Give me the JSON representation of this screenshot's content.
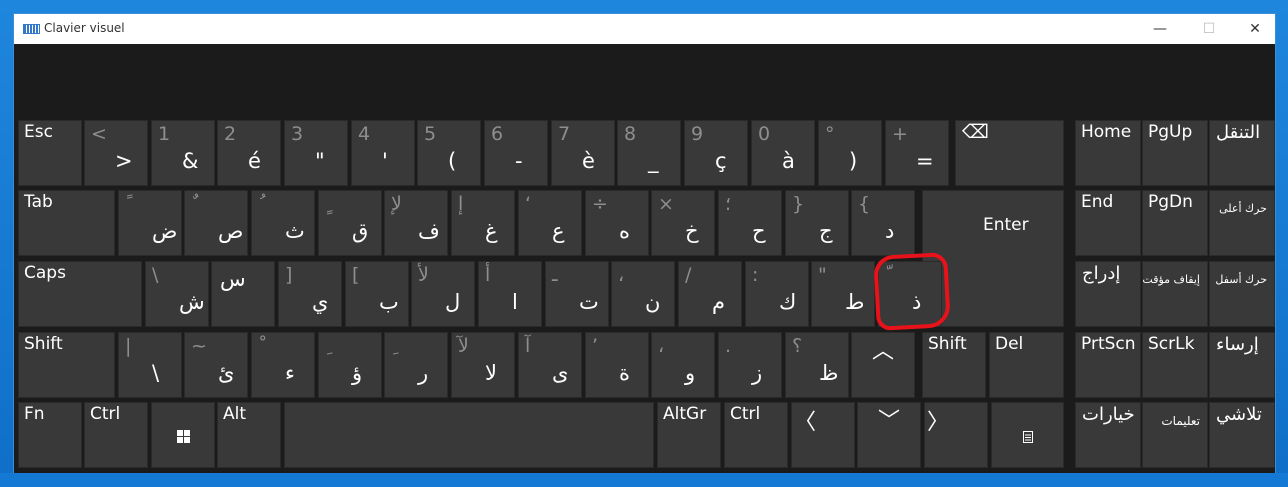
{
  "window": {
    "title": "Clavier visuel",
    "minimize": "—",
    "maximize": "☐",
    "close": "✕"
  },
  "icons": {
    "app": "keyboard-icon",
    "windows": "windows-logo-icon",
    "menu": "menu-icon",
    "backspace": "backspace-icon"
  },
  "colors": {
    "key_bg": "#393939",
    "panel_bg": "#1b1b1b",
    "annotation": "#e8121a",
    "desktop": "#1a7fd6"
  },
  "row1": {
    "esc": "Esc",
    "k_lt": {
      "top": "<",
      "bot": ">"
    },
    "k1": {
      "top": "1",
      "bot": "&"
    },
    "k2": {
      "top": "2",
      "bot": "é"
    },
    "k3": {
      "top": "3",
      "bot": "\""
    },
    "k4": {
      "top": "4",
      "bot": "'"
    },
    "k5": {
      "top": "5",
      "bot": "("
    },
    "k6": {
      "top": "6",
      "bot": "-"
    },
    "k7": {
      "top": "7",
      "bot": "è"
    },
    "k8": {
      "top": "8",
      "bot": "_"
    },
    "k9": {
      "top": "9",
      "bot": "ç"
    },
    "k0": {
      "top": "0",
      "bot": "à"
    },
    "kdeg": {
      "top": "°",
      "bot": ")"
    },
    "kplus": {
      "top": "+",
      "bot": "="
    },
    "backspace": "⌫"
  },
  "row2": {
    "tab": "Tab",
    "a": {
      "top": "ً",
      "bot": "ض"
    },
    "z": {
      "top": "ٌ",
      "bot": "ص"
    },
    "e": {
      "top": "ُ",
      "bot": "ث"
    },
    "r": {
      "top": "ٍ",
      "bot": "ق"
    },
    "t": {
      "top": "لإ",
      "bot": "ف"
    },
    "y": {
      "top": "إ",
      "bot": "غ"
    },
    "u": {
      "top": "‘",
      "bot": "ع"
    },
    "i": {
      "top": "÷",
      "bot": "ه"
    },
    "o": {
      "top": "×",
      "bot": "خ"
    },
    "p": {
      "top": "؛",
      "bot": "ح"
    },
    "brace_r": {
      "top": "}",
      "bot": "ج"
    },
    "brace_l": {
      "top": "{",
      "bot": "د"
    },
    "enter": "Enter"
  },
  "row3": {
    "caps": "Caps",
    "q": {
      "top": "\\",
      "bot": "ش"
    },
    "s": {
      "top": "",
      "bot": "س"
    },
    "d": {
      "top": "]",
      "bot": "ي"
    },
    "f": {
      "top": "[",
      "bot": "ب"
    },
    "g": {
      "top": "لأ",
      "bot": "ل"
    },
    "h": {
      "top": "أ",
      "bot": "ا"
    },
    "j": {
      "top": "ـ",
      "bot": "ت"
    },
    "k": {
      "top": "،",
      "bot": "ن"
    },
    "l": {
      "top": "/",
      "bot": "م"
    },
    "m": {
      "top": ":",
      "bot": "ك"
    },
    "u2": {
      "top": "\"",
      "bot": "ط"
    },
    "star": {
      "top": "ّ",
      "bot": "ذ"
    }
  },
  "row4": {
    "shift": "Shift",
    "pipe": {
      "top": "|",
      "bot": "\\"
    },
    "w": {
      "top": "~",
      "bot": "ئ"
    },
    "x": {
      "top": "ْ",
      "bot": "ء"
    },
    "c": {
      "top": "ِ",
      "bot": "ؤ"
    },
    "v": {
      "top": "ِ",
      "bot": "ر"
    },
    "b": {
      "top": "لآ",
      "bot": "لا"
    },
    "n": {
      "top": "آ",
      "bot": "ى"
    },
    "comma": {
      "top": "’",
      "bot": "ة"
    },
    "semi": {
      "top": "،",
      "bot": "و"
    },
    "colon": {
      "top": ".",
      "bot": "ز"
    },
    "excl": {
      "top": "؟",
      "bot": "ظ"
    },
    "up": "︿",
    "shift_r": "Shift",
    "del": "Del"
  },
  "row5": {
    "fn": "Fn",
    "ctrl": "Ctrl",
    "alt": "Alt",
    "altgr": "AltGr",
    "ctrl_r": "Ctrl",
    "left": "〈",
    "down": "﹀",
    "right": "〉"
  },
  "nav": {
    "home": "Home",
    "pgup": "PgUp",
    "navigate": "التنقل",
    "end": "End",
    "pgdn": "PgDn",
    "move_up": "حرك أعلى",
    "insert": "إدراج",
    "pause": "إيقاف مؤقت",
    "move_down": "حرك أسفل",
    "prtscn": "PrtScn",
    "scrlk": "ScrLk",
    "dock": "إرساء",
    "options": "خيارات",
    "help": "تعليمات",
    "fade": "تلاشي"
  }
}
